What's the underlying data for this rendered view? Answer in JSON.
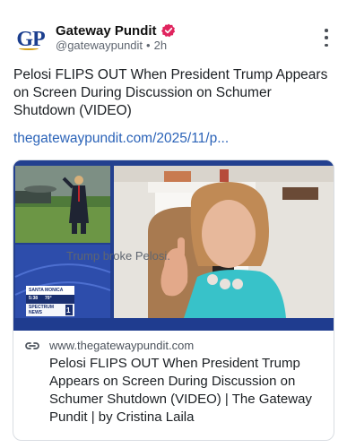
{
  "post": {
    "author": {
      "display_name": "Gateway Pundit",
      "handle": "@gatewaypundit",
      "separator": "•",
      "time": "2h",
      "avatar_text": "GP",
      "verified": true,
      "verified_color": "#e0245e"
    },
    "text": "Pelosi FLIPS OUT When President Trump Appears on Screen During Discussion on Schumer Shutdown (VIDEO)",
    "link_text": "thegatewaypundit.com/2025/11/p...",
    "more_icon": "vertical-ellipsis-icon"
  },
  "card": {
    "domain": "www.thegatewaypundit.com",
    "title": "Pelosi FLIPS OUT When President Trump Appears on Screen During Discussion on Schumer Shutdown (VIDEO) | The Gateway Pundit | by Cristina Laila",
    "description": "Trump broke Pelosi.",
    "link_icon": "link-icon",
    "thumbnail": {
      "news_location": "SANTA MONICA",
      "news_time": "5:38",
      "news_temp": "70°",
      "news_brand": "SPECTRUM",
      "news_brand2": "NEWS",
      "news_channel": "1"
    }
  },
  "colors": {
    "accent_link": "#2b63b8",
    "avatar_blue": "#1c3f8f",
    "thumb_blue": "#23408f"
  }
}
